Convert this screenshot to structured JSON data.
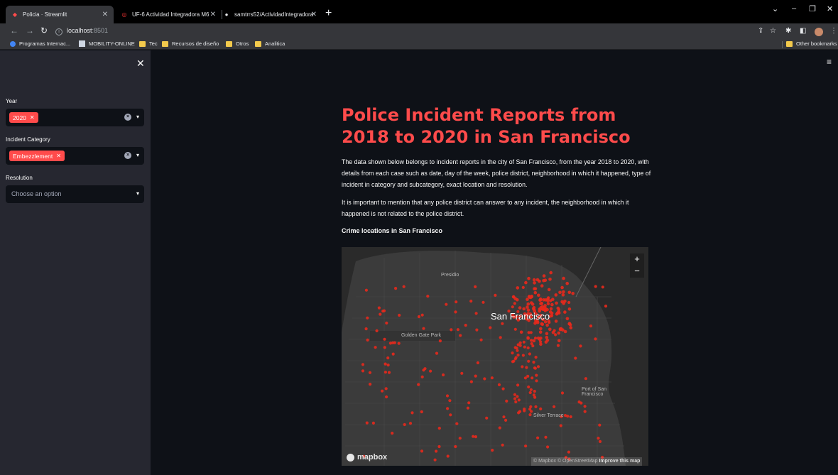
{
  "browser": {
    "tabs": [
      {
        "label": "Policia · Streamlit",
        "active": true
      },
      {
        "label": "UF-6 Actividad Integradora M6",
        "active": false
      },
      {
        "label": "samtrrs52/ActividadIntegradora",
        "active": false
      }
    ],
    "url_host": "localhost",
    "url_port": ":8501",
    "bookmarks": [
      "Programas Internac...",
      "MOBILITY-ONLINE",
      "Tec",
      "Recursos de diseño",
      "Otros",
      "Analitica"
    ],
    "other_bookmarks": "Other bookmarks"
  },
  "sidebar": {
    "filters": [
      {
        "label": "Year",
        "selected_tag": "2020"
      },
      {
        "label": "Incident Category",
        "selected_tag": "Embezzlement"
      },
      {
        "label": "Resolution",
        "placeholder": "Choose an option"
      }
    ]
  },
  "main": {
    "title": "Police Incident Reports from 2018 to 2020 in San Francisco",
    "paragraph1": "The data shown below belongs to incident reports in the city of San Francisco, from the year 2018 to 2020, with details from each case such as date, day of the week, police district, neighborhood in which it happened, type of incident in category and subcategory, exact location and resolution.",
    "paragraph2": "It is important to mention that any police district can answer to any incident, the neighborhood in which it happened is not related to the police district.",
    "map_heading": "Crime locations in San Francisco"
  },
  "map": {
    "city_label": "San Francisco",
    "labels": [
      "Presidio",
      "Golden Gate Park",
      "Port of San Francisco",
      "Silver Terrace"
    ],
    "zoom_in": "+",
    "zoom_out": "−",
    "logo": "mapbox",
    "attribution": "© Mapbox © OpenStreetMap",
    "improve": "Improve this map",
    "point_color": "#e8291c"
  }
}
